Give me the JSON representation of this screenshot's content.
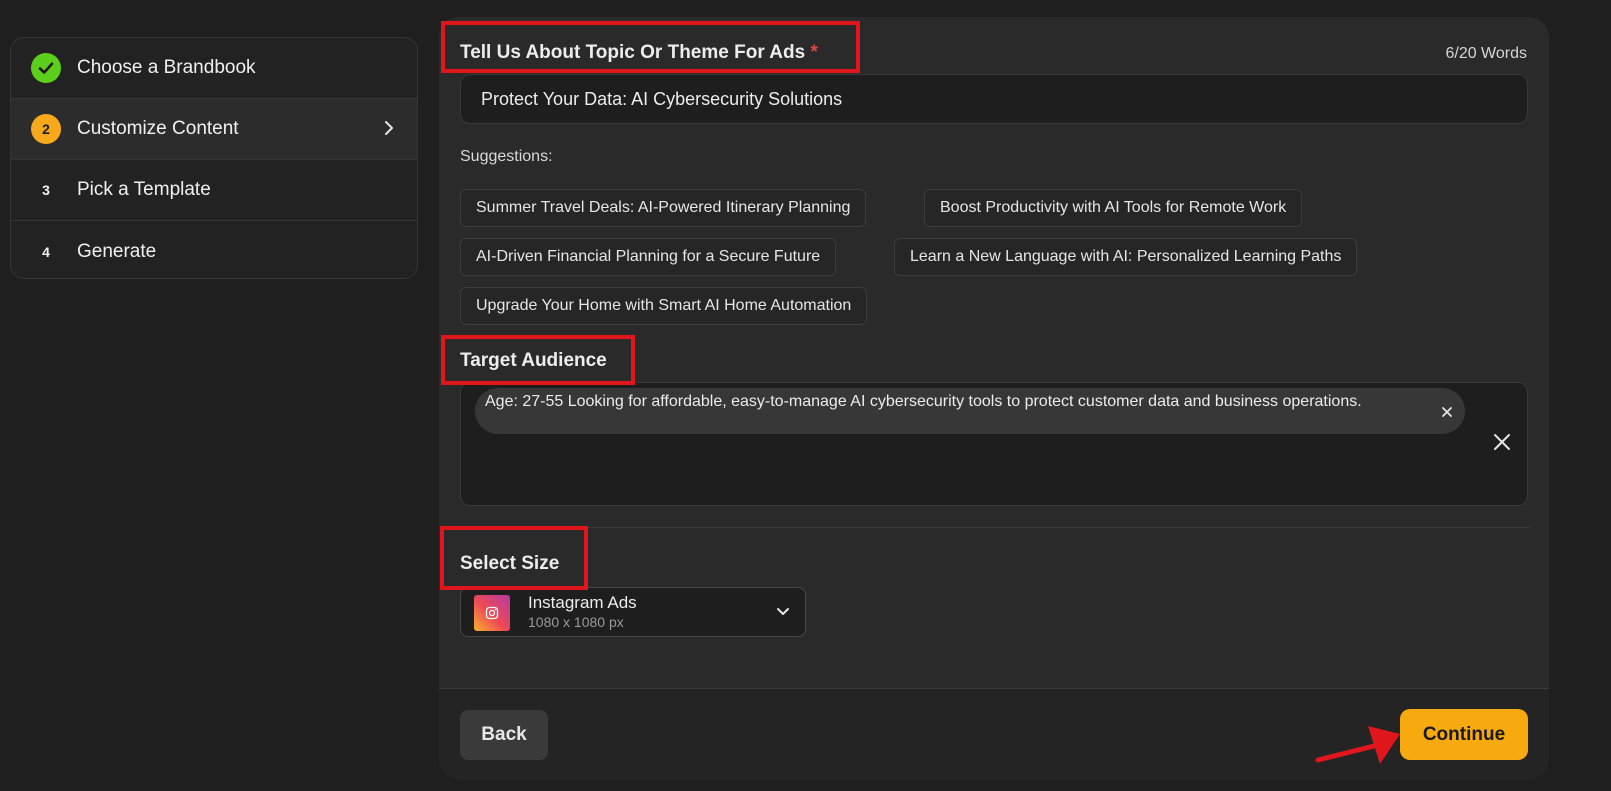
{
  "steps": [
    {
      "label": "Choose a Brandbook",
      "state": "done",
      "marker": ""
    },
    {
      "label": "Customize Content",
      "state": "current",
      "marker": "2"
    },
    {
      "label": "Pick a Template",
      "state": "pending",
      "marker": "3"
    },
    {
      "label": "Generate",
      "state": "pending",
      "marker": "4"
    }
  ],
  "topic": {
    "label": "Tell Us About Topic Or Theme For Ads",
    "required_mark": "*",
    "word_count": "6/20 Words",
    "value": "Protect Your Data: AI Cybersecurity Solutions"
  },
  "suggestions": {
    "title": "Suggestions:",
    "items": [
      "Summer Travel Deals: AI-Powered Itinerary Planning",
      "Boost Productivity with AI Tools for Remote Work",
      "AI-Driven Financial Planning for a Secure Future",
      "Learn a New Language with AI: Personalized Learning Paths",
      "Upgrade Your Home with Smart AI Home Automation"
    ]
  },
  "audience": {
    "label": "Target Audience",
    "tag": "Age: 27-55 Looking for affordable, easy-to-manage AI cybersecurity tools to protect customer data and business operations."
  },
  "size": {
    "label": "Select Size",
    "name": "Instagram Ads",
    "dimensions": "1080 x 1080 px"
  },
  "footer": {
    "back_label": "Back",
    "continue_label": "Continue"
  },
  "colors": {
    "accent": "#f7aa0f",
    "done_green": "#5ccf1c",
    "annotation_red": "#e0161c"
  }
}
